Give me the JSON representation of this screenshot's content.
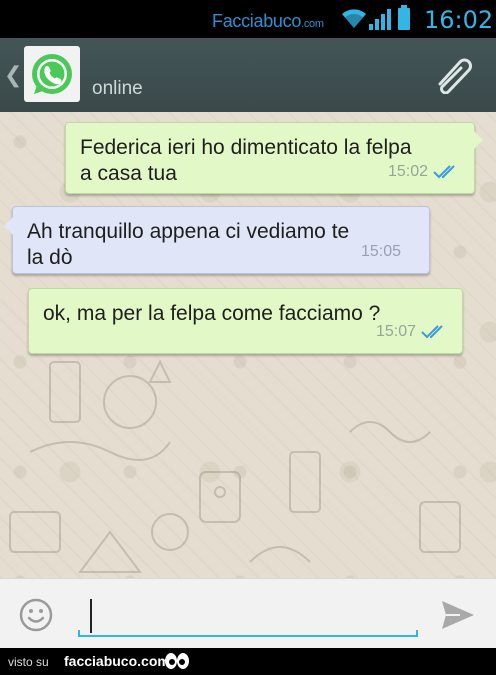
{
  "status_bar": {
    "brand": "Facciabuco",
    "brand_domain": ".com",
    "time": "16:02",
    "accent_color": "#33b5e5"
  },
  "header": {
    "avatar_icon": "whatsapp-logo-icon",
    "contact_status": "online",
    "attach_icon": "paperclip-icon",
    "back_icon": "chevron-left-icon",
    "background_color": "#3f4f50"
  },
  "messages": [
    {
      "direction": "out",
      "lines": [
        "Federica ieri ho dimenticato la felpa",
        "a casa tua"
      ],
      "time": "15:02",
      "read_icon": "double-check-icon"
    },
    {
      "direction": "in",
      "lines": [
        "Ah tranquillo appena ci  vediamo te",
        "la dò"
      ],
      "time": "15:05"
    },
    {
      "direction": "out",
      "lines": [
        "ok, ma per la felpa come facciamo ?"
      ],
      "time": "15:07",
      "read_icon": "double-check-icon"
    }
  ],
  "composer": {
    "value": "",
    "emoji_icon": "smiley-icon",
    "send_icon": "send-arrow-icon"
  },
  "footer": {
    "label": "visto su",
    "brand": "facciabuco.com",
    "eyes_icon": "eyes-icon"
  }
}
